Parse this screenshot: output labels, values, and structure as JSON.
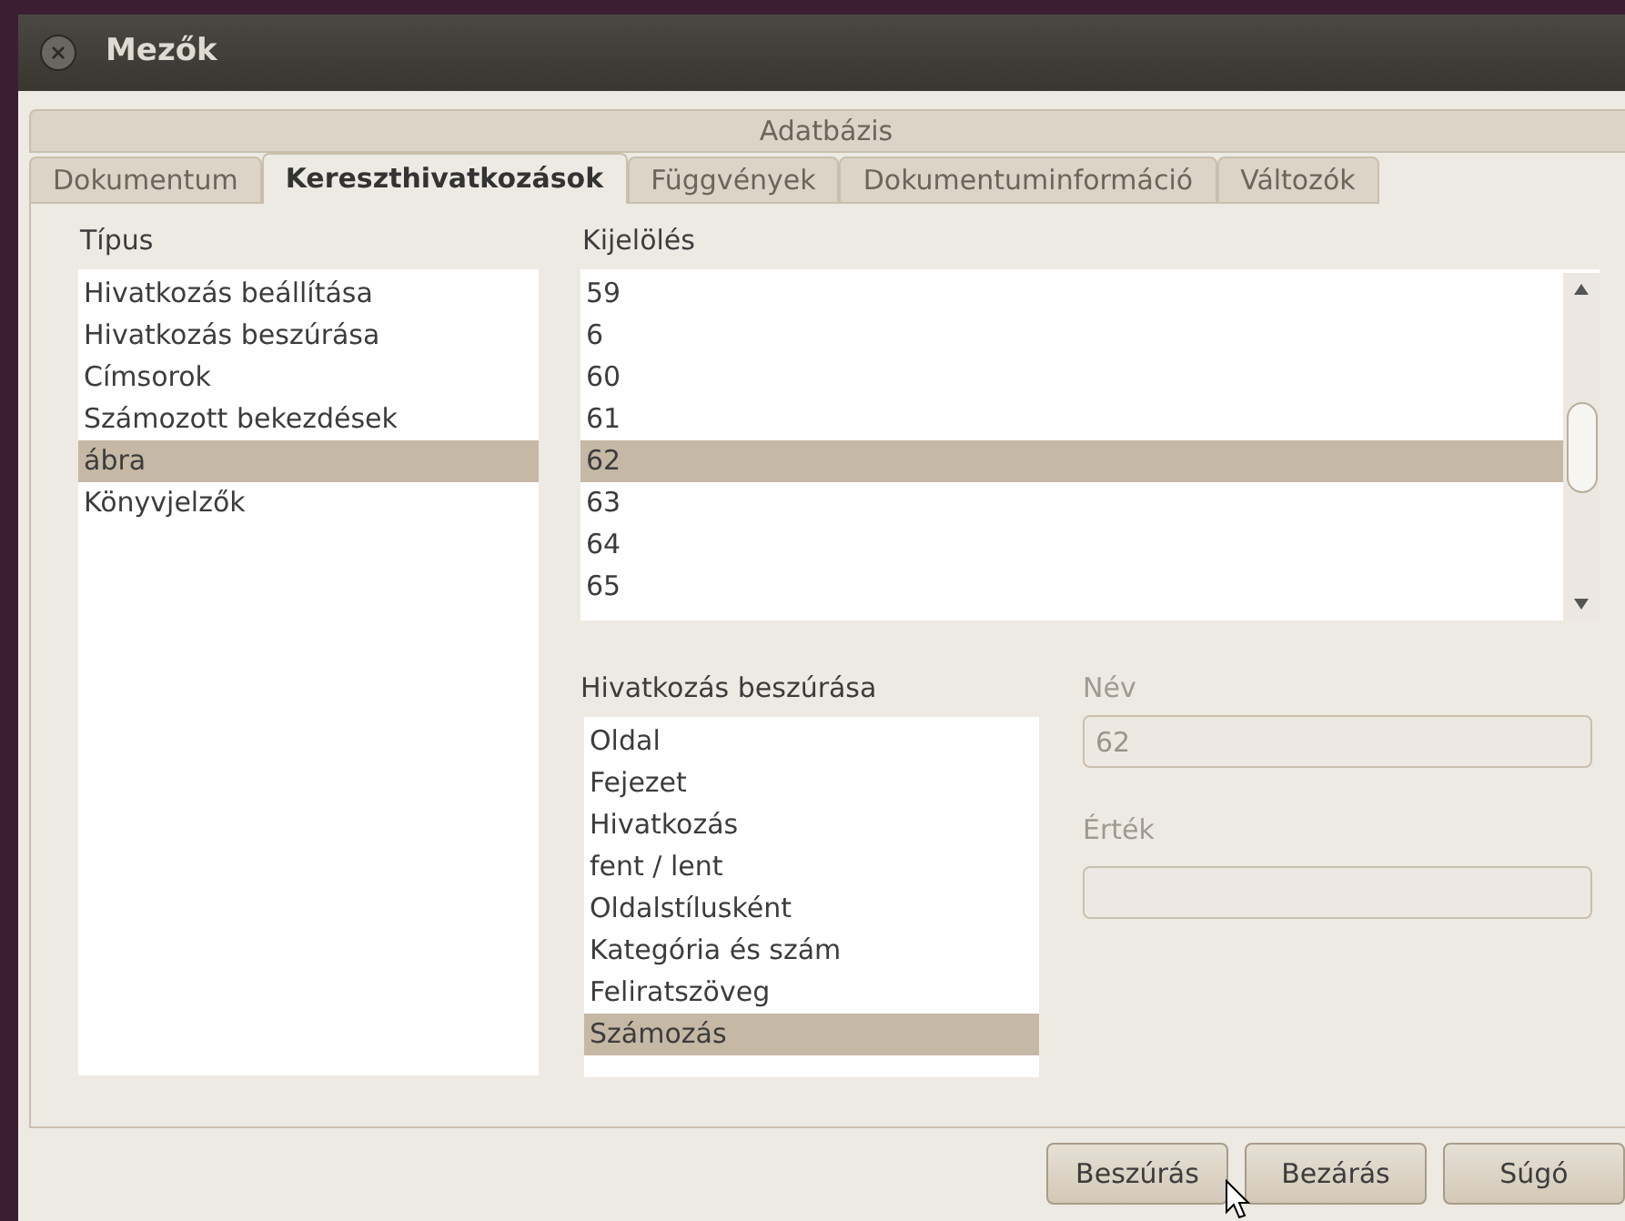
{
  "window": {
    "title": "Mezők"
  },
  "tabs_row_1": [
    {
      "label": "Adatbázis",
      "selected": false
    }
  ],
  "tabs_row_2": [
    {
      "label": "Dokumentum",
      "selected": false
    },
    {
      "label": "Kereszthivatkozások",
      "selected": true
    },
    {
      "label": "Függvények",
      "selected": false
    },
    {
      "label": "Dokumentuminformáció",
      "selected": false
    },
    {
      "label": "Változók",
      "selected": false
    }
  ],
  "type_list": {
    "label": "Típus",
    "items": [
      {
        "label": "Hivatkozás beállítása",
        "selected": false
      },
      {
        "label": "Hivatkozás beszúrása",
        "selected": false
      },
      {
        "label": "Címsorok",
        "selected": false
      },
      {
        "label": "Számozott bekezdések",
        "selected": false
      },
      {
        "label": "ábra",
        "selected": true
      },
      {
        "label": "Könyvjelzők",
        "selected": false
      }
    ]
  },
  "selection_list": {
    "label": "Kijelölés",
    "items": [
      {
        "label": "59",
        "selected": false
      },
      {
        "label": "6",
        "selected": false
      },
      {
        "label": "60",
        "selected": false
      },
      {
        "label": "61",
        "selected": false
      },
      {
        "label": "62",
        "selected": true
      },
      {
        "label": "63",
        "selected": false
      },
      {
        "label": "64",
        "selected": false
      },
      {
        "label": "65",
        "selected": false
      }
    ]
  },
  "insert_reference_list": {
    "label": "Hivatkozás beszúrása",
    "items": [
      {
        "label": "Oldal",
        "selected": false
      },
      {
        "label": "Fejezet",
        "selected": false
      },
      {
        "label": "Hivatkozás",
        "selected": false
      },
      {
        "label": "fent / lent",
        "selected": false
      },
      {
        "label": "Oldalstílusként",
        "selected": false
      },
      {
        "label": "Kategória és szám",
        "selected": false
      },
      {
        "label": "Feliratszöveg",
        "selected": false
      },
      {
        "label": "Számozás",
        "selected": true
      }
    ]
  },
  "name_field": {
    "label": "Név",
    "value": "62",
    "disabled": true
  },
  "value_field": {
    "label": "Érték",
    "disabled": true
  },
  "buttons": [
    {
      "label": "Beszúrás"
    },
    {
      "label": "Bezárás"
    },
    {
      "label": "Súgó"
    }
  ]
}
